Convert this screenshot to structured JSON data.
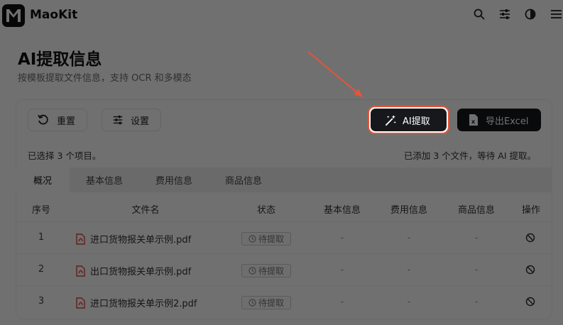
{
  "app": {
    "name": "MaoKit"
  },
  "header_icons": [
    "search-icon",
    "sliders-icon",
    "contrast-icon",
    "menu-icon"
  ],
  "page": {
    "title": "AI提取信息",
    "subtitle": "按模板提取文件信息，支持 OCR 和多模态"
  },
  "toolbar": {
    "reset_label": "重置",
    "settings_label": "设置",
    "ai_extract_label": "AI提取",
    "export_label": "导出Excel"
  },
  "status": {
    "selected_text": "已选择 3 个项目。",
    "info_text": "已添加 3 个文件，等待 AI 提取。"
  },
  "tabs": [
    {
      "label": "概况",
      "active": true
    },
    {
      "label": "基本信息",
      "active": false
    },
    {
      "label": "费用信息",
      "active": false
    },
    {
      "label": "商品信息",
      "active": false
    }
  ],
  "table": {
    "headers": [
      "序号",
      "文件名",
      "状态",
      "基本信息",
      "费用信息",
      "商品信息",
      "操作"
    ],
    "rows": [
      {
        "no": "1",
        "file": "进口货物报关单示例.pdf",
        "status": "待提取",
        "basic": "-",
        "fee": "-",
        "goods": "-"
      },
      {
        "no": "2",
        "file": "出口货物报关单示例.pdf",
        "status": "待提取",
        "basic": "-",
        "fee": "-",
        "goods": "-"
      },
      {
        "no": "3",
        "file": "进口货物报关单示例2.pdf",
        "status": "待提取",
        "basic": "-",
        "fee": "-",
        "goods": "-"
      }
    ]
  },
  "colors": {
    "highlight": "#e3553a",
    "primary_button": "#16181b",
    "overlay": "rgba(0,0,0,0.56)"
  }
}
